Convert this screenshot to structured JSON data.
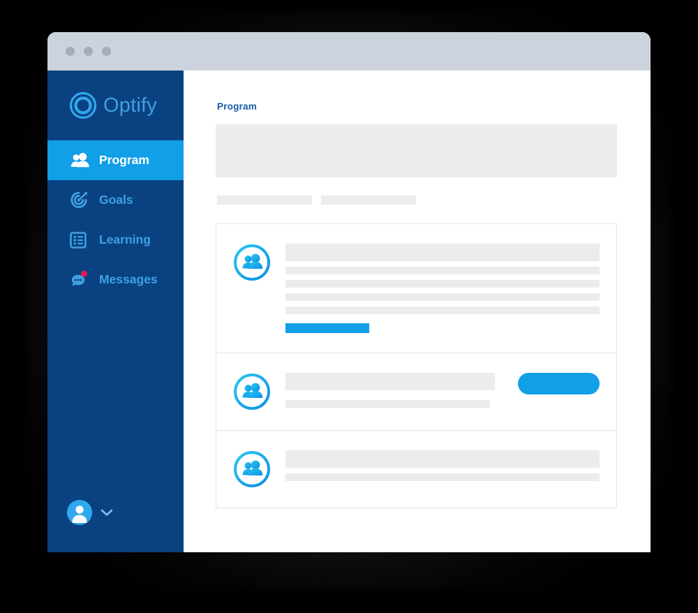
{
  "window": {
    "titlebar_dots": [
      "window-dot-1",
      "window-dot-2",
      "window-dot-3"
    ]
  },
  "brand": {
    "name": "Optify",
    "logo_icon": "optify-circle-logo",
    "logo_color": "#3fa0e0"
  },
  "sidebar": {
    "background_color": "#0a4281",
    "active_color": "#119fe8",
    "text_color": "#3fa0e0",
    "items": [
      {
        "label": "Program",
        "icon": "people-icon",
        "active": true,
        "badge": false
      },
      {
        "label": "Goals",
        "icon": "target-icon",
        "active": false,
        "badge": false
      },
      {
        "label": "Learning",
        "icon": "list-icon",
        "active": false,
        "badge": false
      },
      {
        "label": "Messages",
        "icon": "chat-bubble-icon",
        "active": false,
        "badge": true,
        "badge_color": "#ed1556"
      }
    ],
    "profile": {
      "avatar_icon": "user-avatar-icon",
      "chevron_icon": "chevron-down-icon",
      "avatar_color": "#2fa8ee"
    }
  },
  "main": {
    "page_title": "Program",
    "page_title_color": "#1b59a8",
    "hero_placeholder": "hero-banner-placeholder",
    "chips": [
      "chip-placeholder-1",
      "chip-placeholder-2"
    ],
    "placeholder_color": "#ececec",
    "accent_color": "#119fe8",
    "cards": [
      {
        "icon": "people-circle-icon",
        "layout": "stacked",
        "title_bar": "title-placeholder",
        "line_bars": [
          "line-1",
          "line-2",
          "line-3",
          "line-4"
        ],
        "action_bar": "primary-action-bar",
        "has_pill_button": false
      },
      {
        "icon": "people-circle-icon",
        "layout": "inline-action",
        "title_bar": "title-placeholder",
        "line_bars": [
          "line-1"
        ],
        "action_bar": null,
        "has_pill_button": true,
        "pill_button": "primary-pill-button"
      },
      {
        "icon": "people-circle-icon",
        "layout": "stacked",
        "title_bar": "title-placeholder",
        "line_bars": [
          "line-1"
        ],
        "action_bar": null,
        "has_pill_button": false
      }
    ]
  }
}
